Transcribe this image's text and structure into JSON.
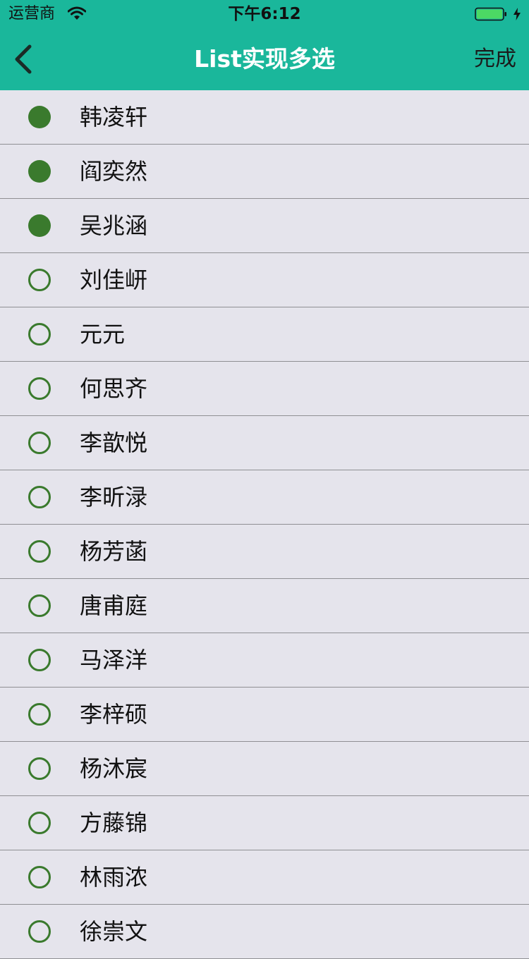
{
  "status_bar": {
    "carrier": "运营商",
    "time": "下午6:12"
  },
  "nav": {
    "title": "List实现多选",
    "done_label": "完成"
  },
  "colors": {
    "accent": "#1ab79b",
    "radio_green": "#3a7a2d",
    "background": "#e5e4ec"
  },
  "items": [
    {
      "name": "韩凌轩",
      "selected": true
    },
    {
      "name": "阎奕然",
      "selected": true
    },
    {
      "name": "吴兆涵",
      "selected": true
    },
    {
      "name": "刘佳岍",
      "selected": false
    },
    {
      "name": "元元",
      "selected": false
    },
    {
      "name": "何思齐",
      "selected": false
    },
    {
      "name": "李歆悦",
      "selected": false
    },
    {
      "name": "李昕渌",
      "selected": false
    },
    {
      "name": "杨芳菡",
      "selected": false
    },
    {
      "name": "唐甫庭",
      "selected": false
    },
    {
      "name": "马泽洋",
      "selected": false
    },
    {
      "name": "李梓硕",
      "selected": false
    },
    {
      "name": "杨沐宸",
      "selected": false
    },
    {
      "name": "方藤锦",
      "selected": false
    },
    {
      "name": "林雨浓",
      "selected": false
    },
    {
      "name": "徐崇文",
      "selected": false
    }
  ]
}
